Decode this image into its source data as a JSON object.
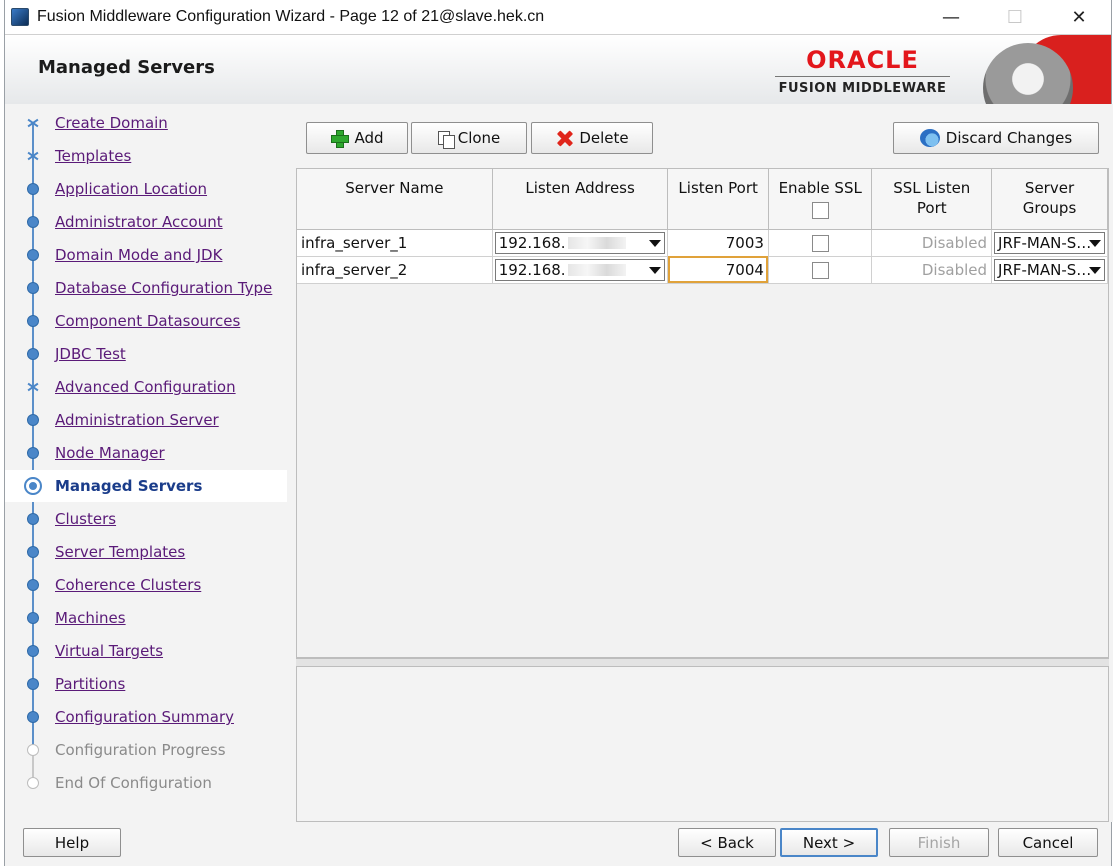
{
  "window": {
    "title": "Fusion Middleware Configuration Wizard - Page 12 of 21@slave.hek.cn",
    "minimize_glyph": "—",
    "maximize_glyph": "☐",
    "close_glyph": "✕"
  },
  "header": {
    "page_title": "Managed Servers",
    "brand_name": "ORACLE",
    "brand_product": "FUSION MIDDLEWARE"
  },
  "sidebar": {
    "items": [
      {
        "label": "Create Domain",
        "state": "done"
      },
      {
        "label": "Templates",
        "state": "done"
      },
      {
        "label": "Application Location",
        "state": "done"
      },
      {
        "label": "Administrator Account",
        "state": "done"
      },
      {
        "label": "Domain Mode and JDK",
        "state": "done"
      },
      {
        "label": "Database Configuration Type",
        "state": "done"
      },
      {
        "label": "Component Datasources",
        "state": "done"
      },
      {
        "label": "JDBC Test",
        "state": "done"
      },
      {
        "label": "Advanced Configuration",
        "state": "done"
      },
      {
        "label": "Administration Server",
        "state": "done"
      },
      {
        "label": "Node Manager",
        "state": "done"
      },
      {
        "label": "Managed Servers",
        "state": "current"
      },
      {
        "label": "Clusters",
        "state": "done"
      },
      {
        "label": "Server Templates",
        "state": "done"
      },
      {
        "label": "Coherence Clusters",
        "state": "done"
      },
      {
        "label": "Machines",
        "state": "done"
      },
      {
        "label": "Virtual Targets",
        "state": "done"
      },
      {
        "label": "Partitions",
        "state": "done"
      },
      {
        "label": "Configuration Summary",
        "state": "done"
      },
      {
        "label": "Configuration Progress",
        "state": "pending"
      },
      {
        "label": "End Of Configuration",
        "state": "pending"
      }
    ]
  },
  "toolbar": {
    "add_label": "Add",
    "clone_label": "Clone",
    "delete_label": "Delete",
    "discard_label": "Discard Changes"
  },
  "table": {
    "columns": {
      "server_name": "Server Name",
      "listen_address": "Listen Address",
      "listen_port": "Listen Port",
      "enable_ssl": "Enable SSL",
      "ssl_listen_port_1": "SSL Listen",
      "ssl_listen_port_2": "Port",
      "server_groups_1": "Server",
      "server_groups_2": "Groups"
    },
    "rows": [
      {
        "server_name": "infra_server_1",
        "listen_address": "192.168.",
        "listen_port": "7003",
        "ssl_port": "Disabled",
        "server_groups": "JRF-MAN-S…"
      },
      {
        "server_name": "infra_server_2",
        "listen_address": "192.168.",
        "listen_port": "7004",
        "ssl_port": "Disabled",
        "server_groups": "JRF-MAN-S…"
      }
    ]
  },
  "footer": {
    "help_label": "Help",
    "back_label": "< Back",
    "next_label": "Next >",
    "finish_label": "Finish",
    "cancel_label": "Cancel"
  },
  "colors": {
    "nav_done": "#4a86c8",
    "nav_link": "#5a1a78",
    "brand_red": "#e3161b",
    "focus_border": "#e0a23a"
  }
}
